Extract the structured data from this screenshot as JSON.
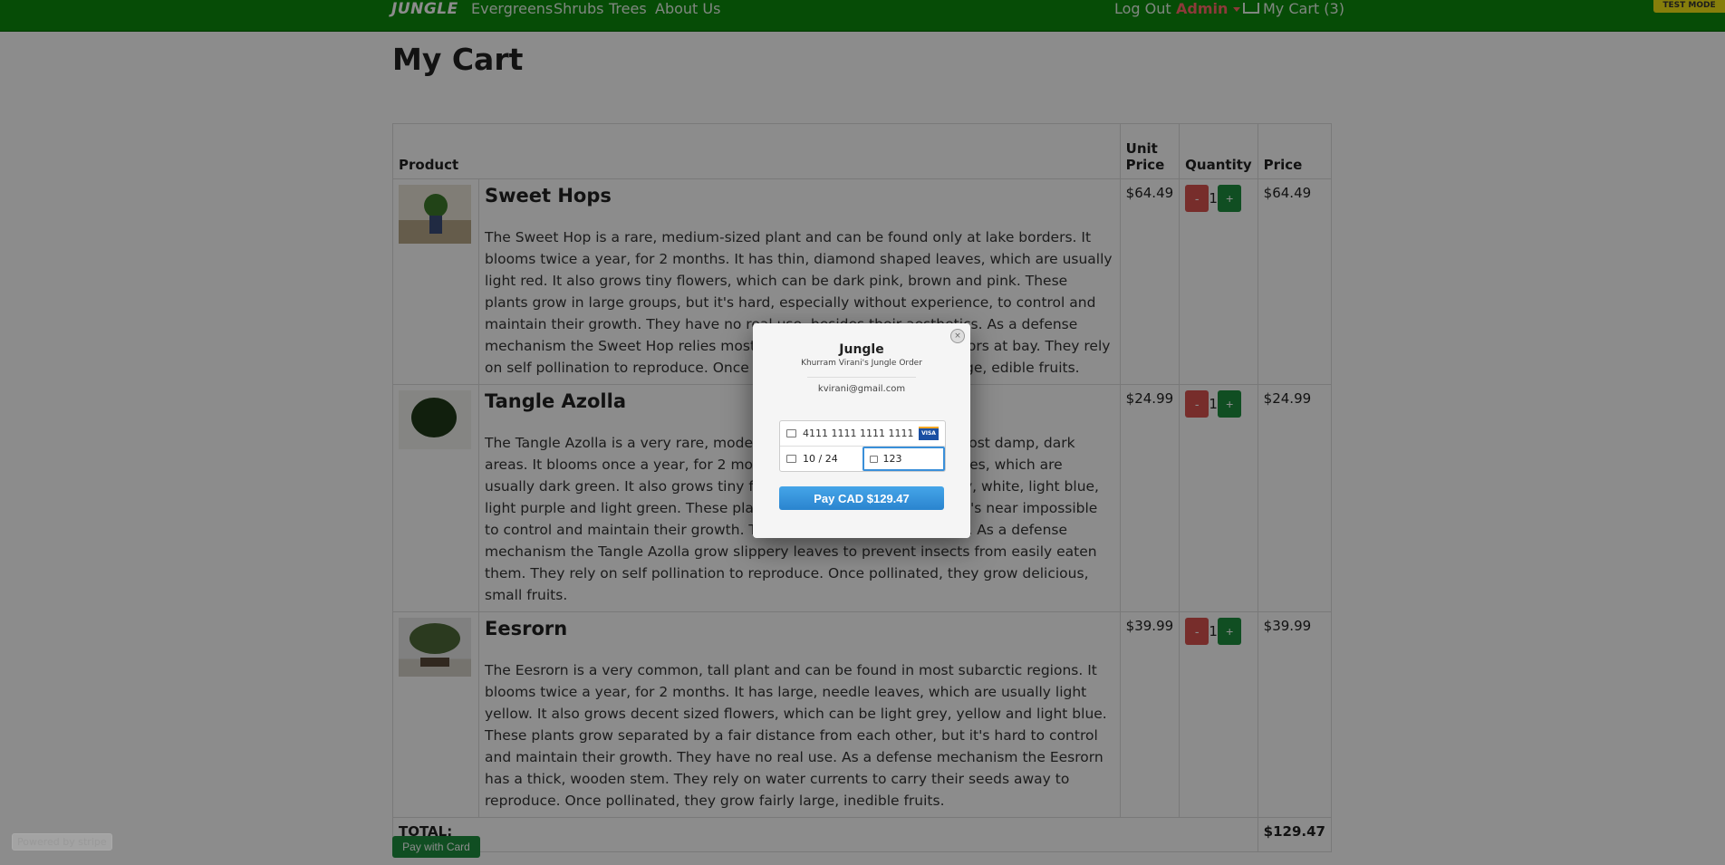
{
  "nav": {
    "brand": "JUNGLE",
    "links": [
      "Evergreens",
      "Shrubs",
      "Trees",
      "About Us"
    ],
    "logout": "Log Out",
    "admin": "Admin",
    "cart": "My Cart (3)",
    "test_mode": "TEST MODE"
  },
  "page": {
    "title": "My Cart"
  },
  "table": {
    "headers": {
      "product": "Product",
      "unit_price": "Unit Price",
      "quantity": "Quantity",
      "price": "Price"
    },
    "items": [
      {
        "name": "Sweet Hops",
        "description": "The Sweet Hop is a rare, medium-sized plant and can be found only at lake borders. It blooms twice a year, for 2 months. It has thin, diamond shaped leaves, which are usually light red. It also grows tiny flowers, which can be dark pink, brown and pink. These plants grow in large groups, but it's hard, especially without experience, to control and maintain their growth. They have no real use, besides their aesthetics. As a defense mechanism the Sweet Hop relies mostly on its thorns to keep predators at bay. They rely on self pollination to reproduce. Once pollinated, they grow fairly large, edible fruits.",
        "unit_price": "$64.49",
        "quantity": "1",
        "price": "$64.49"
      },
      {
        "name": "Tangle Azolla",
        "description": "The Tangle Azolla is a very rare, modest plant and can be found in most damp, dark areas. It blooms once a year, for 2 months. It has wide, palmate leaves, which are usually dark green. It also grows tiny flowers, which can be light grey, white, light blue, light purple and light green. These plants grow in large groups, but it's near impossible to control and maintain their growth. They are often used in gardens. As a defense mechanism the Tangle Azolla grow slippery leaves to prevent insects from easily eaten them. They rely on self pollination to reproduce. Once pollinated, they grow delicious, small fruits.",
        "unit_price": "$24.99",
        "quantity": "1",
        "price": "$24.99"
      },
      {
        "name": "Eesrorn",
        "description": "The Eesrorn is a very common, tall plant and can be found in most subarctic regions. It blooms twice a year, for 2 months. It has large, needle leaves, which are usually light yellow. It also grows decent sized flowers, which can be light grey, yellow and light blue. These plants grow separated by a fair distance from each other, but it's hard to control and maintain their growth. They have no real use. As a defense mechanism the Eesrorn has a thick, wooden stem. They rely on water currents to carry their seeds away to reproduce. Once pollinated, they grow fairly large, inedible fruits.",
        "unit_price": "$39.99",
        "quantity": "1",
        "price": "$39.99"
      }
    ],
    "minus": "-",
    "plus": "+",
    "total_label": "TOTAL:",
    "total_value": "$129.47"
  },
  "pay_card_label": "Pay with Card",
  "powered_by": "Powered by stripe",
  "modal": {
    "title": "Jungle",
    "subtitle": "Khurram Virani's Jungle Order",
    "email": "kvirani@gmail.com",
    "card_number": "4111 1111 1111 1111",
    "card_brand": "VISA",
    "expiry": "10 / 24",
    "cvc": "123",
    "pay_label": "Pay CAD $129.47",
    "close": "×"
  }
}
